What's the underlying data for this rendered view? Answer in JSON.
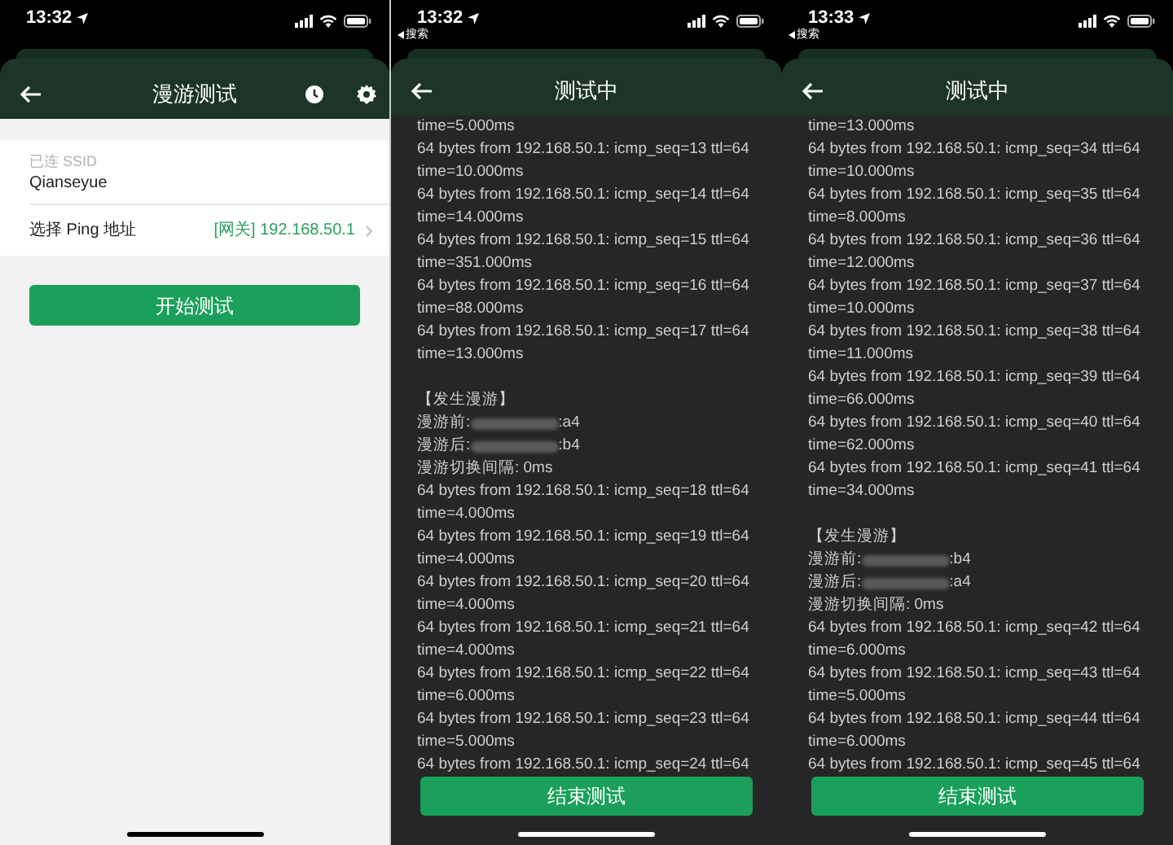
{
  "screens": [
    {
      "kind": "setup",
      "status_bar": {
        "time": "13:32"
      },
      "title": "漫游测试",
      "ssid_label": "已连 SSID",
      "ssid": "Qianseyue",
      "ping_label": "选择 Ping 地址",
      "ping_value": "[网关] 192.168.50.1",
      "button": "开始测试"
    },
    {
      "kind": "log",
      "status_bar": {
        "time": "13:32",
        "back_label": "搜索"
      },
      "title": "测试中",
      "button": "结束测试",
      "log": [
        {
          "kind": "text",
          "text": "time=5.000ms"
        },
        {
          "kind": "text",
          "text": "64 bytes from 192.168.50.1: icmp_seq=13 ttl=64"
        },
        {
          "kind": "text",
          "text": "time=10.000ms"
        },
        {
          "kind": "text",
          "text": "64 bytes from 192.168.50.1: icmp_seq=14 ttl=64"
        },
        {
          "kind": "text",
          "text": "time=14.000ms"
        },
        {
          "kind": "text",
          "text": "64 bytes from 192.168.50.1: icmp_seq=15 ttl=64"
        },
        {
          "kind": "text",
          "text": "time=351.000ms"
        },
        {
          "kind": "text",
          "text": "64 bytes from 192.168.50.1: icmp_seq=16 ttl=64"
        },
        {
          "kind": "text",
          "text": "time=88.000ms"
        },
        {
          "kind": "text",
          "text": "64 bytes from 192.168.50.1: icmp_seq=17 ttl=64"
        },
        {
          "kind": "text",
          "text": "time=13.000ms"
        },
        {
          "kind": "gap"
        },
        {
          "kind": "text",
          "text": "【发生漫游】"
        },
        {
          "kind": "redacted",
          "label": "漫游前:",
          "suffix": ":a4"
        },
        {
          "kind": "redacted",
          "label": "漫游后:",
          "suffix": ":b4"
        },
        {
          "kind": "text",
          "text": "漫游切换间隔: 0ms"
        },
        {
          "kind": "text",
          "text": "64 bytes from 192.168.50.1: icmp_seq=18 ttl=64"
        },
        {
          "kind": "text",
          "text": "time=4.000ms"
        },
        {
          "kind": "text",
          "text": "64 bytes from 192.168.50.1: icmp_seq=19 ttl=64"
        },
        {
          "kind": "text",
          "text": "time=4.000ms"
        },
        {
          "kind": "text",
          "text": "64 bytes from 192.168.50.1: icmp_seq=20 ttl=64"
        },
        {
          "kind": "text",
          "text": "time=4.000ms"
        },
        {
          "kind": "text",
          "text": "64 bytes from 192.168.50.1: icmp_seq=21 ttl=64"
        },
        {
          "kind": "text",
          "text": "time=4.000ms"
        },
        {
          "kind": "text",
          "text": "64 bytes from 192.168.50.1: icmp_seq=22 ttl=64"
        },
        {
          "kind": "text",
          "text": "time=6.000ms"
        },
        {
          "kind": "text",
          "text": "64 bytes from 192.168.50.1: icmp_seq=23 ttl=64"
        },
        {
          "kind": "text",
          "text": "time=5.000ms"
        },
        {
          "kind": "text",
          "text": "64 bytes from 192.168.50.1: icmp_seq=24 ttl=64"
        }
      ]
    },
    {
      "kind": "log",
      "status_bar": {
        "time": "13:33",
        "back_label": "搜索"
      },
      "title": "测试中",
      "button": "结束测试",
      "log": [
        {
          "kind": "text",
          "text": "time=13.000ms"
        },
        {
          "kind": "text",
          "text": "64 bytes from 192.168.50.1: icmp_seq=34 ttl=64"
        },
        {
          "kind": "text",
          "text": "time=10.000ms"
        },
        {
          "kind": "text",
          "text": "64 bytes from 192.168.50.1: icmp_seq=35 ttl=64"
        },
        {
          "kind": "text",
          "text": "time=8.000ms"
        },
        {
          "kind": "text",
          "text": "64 bytes from 192.168.50.1: icmp_seq=36 ttl=64"
        },
        {
          "kind": "text",
          "text": "time=12.000ms"
        },
        {
          "kind": "text",
          "text": "64 bytes from 192.168.50.1: icmp_seq=37 ttl=64"
        },
        {
          "kind": "text",
          "text": "time=10.000ms"
        },
        {
          "kind": "text",
          "text": "64 bytes from 192.168.50.1: icmp_seq=38 ttl=64"
        },
        {
          "kind": "text",
          "text": "time=11.000ms"
        },
        {
          "kind": "text",
          "text": "64 bytes from 192.168.50.1: icmp_seq=39 ttl=64"
        },
        {
          "kind": "text",
          "text": "time=66.000ms"
        },
        {
          "kind": "text",
          "text": "64 bytes from 192.168.50.1: icmp_seq=40 ttl=64"
        },
        {
          "kind": "text",
          "text": "time=62.000ms"
        },
        {
          "kind": "text",
          "text": "64 bytes from 192.168.50.1: icmp_seq=41 ttl=64"
        },
        {
          "kind": "text",
          "text": "time=34.000ms"
        },
        {
          "kind": "gap"
        },
        {
          "kind": "text",
          "text": "【发生漫游】"
        },
        {
          "kind": "redacted",
          "label": "漫游前:",
          "suffix": ":b4"
        },
        {
          "kind": "redacted",
          "label": "漫游后:",
          "suffix": ":a4"
        },
        {
          "kind": "text",
          "text": "漫游切换间隔: 0ms"
        },
        {
          "kind": "text",
          "text": "64 bytes from 192.168.50.1: icmp_seq=42 ttl=64"
        },
        {
          "kind": "text",
          "text": "time=6.000ms"
        },
        {
          "kind": "text",
          "text": "64 bytes from 192.168.50.1: icmp_seq=43 ttl=64"
        },
        {
          "kind": "text",
          "text": "time=5.000ms"
        },
        {
          "kind": "text",
          "text": "64 bytes from 192.168.50.1: icmp_seq=44 ttl=64"
        },
        {
          "kind": "text",
          "text": "time=6.000ms"
        },
        {
          "kind": "text",
          "text": "64 bytes from 192.168.50.1: icmp_seq=45 ttl=64"
        }
      ]
    }
  ]
}
